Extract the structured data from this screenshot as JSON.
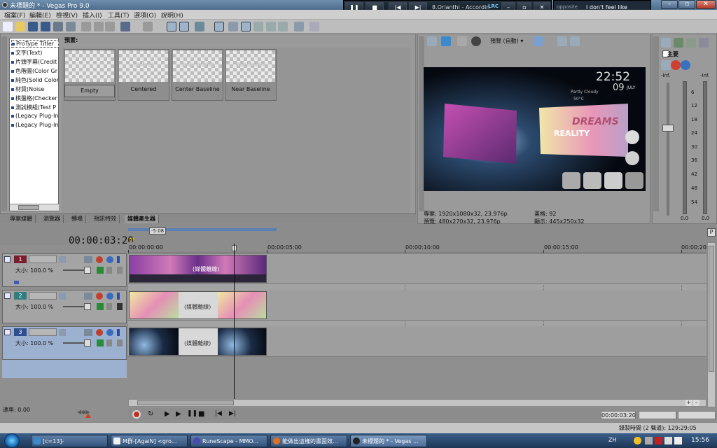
{
  "window": {
    "title": "未標題的 * - Vegas Pro 9.0"
  },
  "player": {
    "track": "8.Orianthi - Accordin",
    "lrc_label": "LRC",
    "lyric_prefix": "opposite",
    "lyric_text": "I don't feel like stopping it"
  },
  "menu": [
    "檔案(F)",
    "編輯(E)",
    "檢視(V)",
    "插入(I)",
    "工具(T)",
    "選項(O)",
    "說明(H)"
  ],
  "generators": {
    "items": [
      "ProType Titler",
      "文字(Text)",
      "片頭字幕(Credit",
      "色階圖(Color Gr",
      "純色(Solid Color",
      "材質(Noise",
      "棋盤格(Checker",
      "測試模組(Test P",
      "(Legacy Plug-In",
      "(Legacy Plug-In"
    ],
    "selected_index": 0,
    "presets_label": "預置:",
    "presets": [
      {
        "label": "Empty",
        "overlay": ""
      },
      {
        "label": "Centered",
        "overlay": "Centered"
      },
      {
        "label": "Center Baseline",
        "overlay": "Center Baseline"
      },
      {
        "label": "Near Baseline",
        "overlay": "Near Baseline"
      }
    ]
  },
  "tabs": [
    "專案媒體",
    "瀏覽器",
    "轉場",
    "視訊特效",
    "媒體產生器"
  ],
  "active_tab": 4,
  "preview": {
    "quality": "預覽 (自動)",
    "clock": "22:52",
    "date": "09",
    "month": "JULY",
    "weather": "Partly Cloudy",
    "temp": "50°C",
    "logo_top": "DREAMS",
    "logo_bottom": "REALITY",
    "info": {
      "project": "專案: 1920x1080x32, 23.976p",
      "preview": "預覽: 480x270x32, 23.976p",
      "frame": "畫格: 92",
      "display": "顯示: 445x250x32"
    }
  },
  "master": {
    "title": "主要",
    "inf_left": "-Inf.",
    "inf_right": "-Inf.",
    "scale": [
      "6",
      "12",
      "18",
      "24",
      "30",
      "36",
      "42",
      "48",
      "54"
    ],
    "val_left": "0.0",
    "val_right": "0.0"
  },
  "timeline": {
    "loop_marker": "-5:08",
    "timecode": "00:00:03:20",
    "ruler": [
      "00:00:00:00",
      "00:00:05:00",
      "00:00:10:00",
      "00:00:15:00",
      "00:00:20:"
    ],
    "tracks": [
      {
        "num": "1",
        "size": "大小: 100.0 %",
        "color": "#7a1e2e",
        "clip_text": "(媒體離線)"
      },
      {
        "num": "2",
        "size": "大小: 100.0 %",
        "color": "#2f7d7d",
        "clip_text": "(媒體離線)"
      },
      {
        "num": "3",
        "size": "大小: 100.0 %",
        "color": "#2e4f8f",
        "clip_text": "(媒體離線)"
      }
    ],
    "rate": "速率: 0.00",
    "end_timecode": "00:00:03:20",
    "record_time": "錄製時間 (2 聲道): 129:29:05"
  },
  "taskbar": {
    "tasks": [
      "[c=13]-",
      "M群-[AgaiN] <gro...",
      "RuneScape - MMO...",
      "能做出這樣的畫面效...",
      "未標題的 * - Vegas ..."
    ],
    "lang": "ZH",
    "clock": "15:56"
  },
  "colors": {
    "accent": "#2e4f8f",
    "titlebar": "#5a7898"
  }
}
